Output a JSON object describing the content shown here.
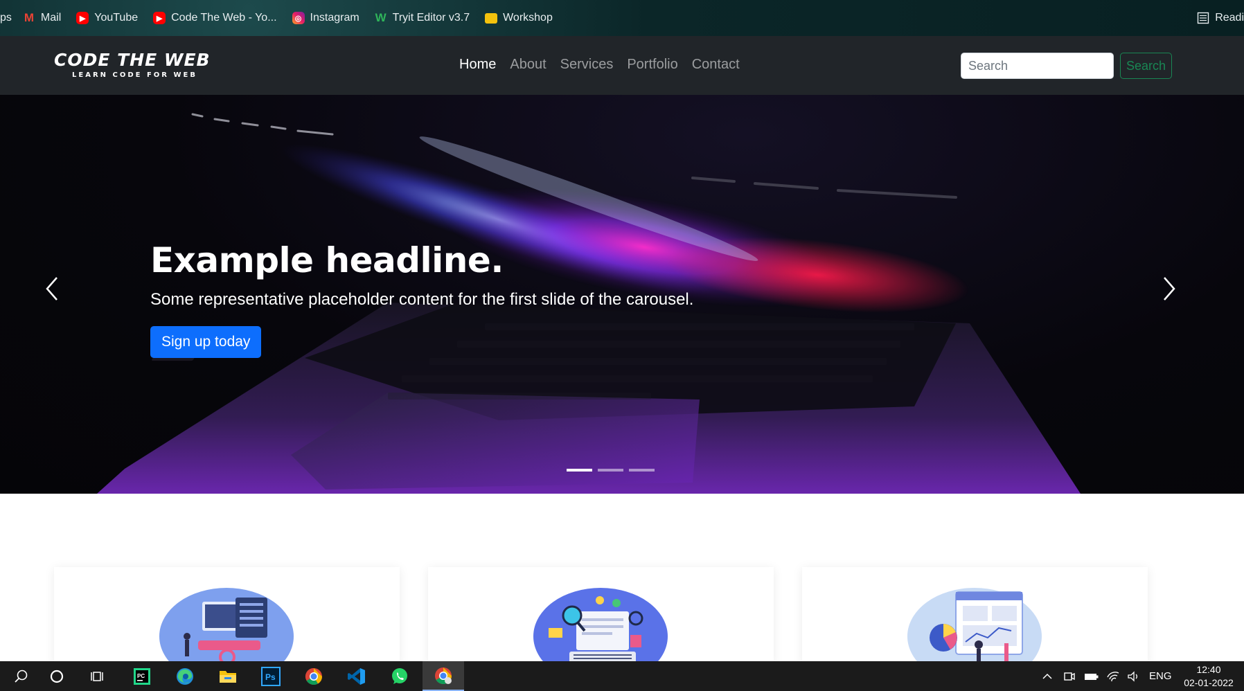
{
  "bookmarks": {
    "items": [
      {
        "label": "ps",
        "icon": "apps-icon"
      },
      {
        "label": "Mail",
        "icon": "gmail-icon"
      },
      {
        "label": "YouTube",
        "icon": "youtube-icon"
      },
      {
        "label": "Code The Web - Yo...",
        "icon": "youtube-icon"
      },
      {
        "label": "Instagram",
        "icon": "instagram-icon"
      },
      {
        "label": "Tryit Editor v3.7",
        "icon": "w3schools-icon"
      },
      {
        "label": "Workshop",
        "icon": "folder-icon"
      }
    ],
    "reading_list": "Readi"
  },
  "navbar": {
    "logo_main": "CODE THE WEB",
    "logo_sub": "LEARN CODE FOR WEB",
    "links": [
      "Home",
      "About",
      "Services",
      "Portfolio",
      "Contact"
    ],
    "active_link": "Home",
    "search_placeholder": "Search",
    "search_button": "Search",
    "colors": {
      "background": "#212529",
      "search_button": "#198754"
    }
  },
  "carousel": {
    "headline": "Example headline.",
    "text": "Some representative placeholder content for the first slide of the carousel.",
    "button": "Sign up today",
    "button_color": "#0d6efd",
    "slides": 3,
    "active_slide": 1,
    "prev_icon": "chevron-left-icon",
    "next_icon": "chevron-right-icon"
  },
  "cards": [
    {
      "illustration": "computer-analytics-illustration"
    },
    {
      "illustration": "seo-keyboard-illustration"
    },
    {
      "illustration": "dashboard-charts-illustration"
    }
  ],
  "taskbar": {
    "apps": [
      "search-icon",
      "cortana-icon",
      "task-view-icon",
      "pycharm-icon",
      "edge-icon",
      "file-explorer-icon",
      "photoshop-icon",
      "chrome-icon",
      "vscode-icon",
      "whatsapp-icon",
      "chrome-active-icon"
    ],
    "language": "ENG",
    "time": "12:40",
    "date": "02-01-2022"
  }
}
